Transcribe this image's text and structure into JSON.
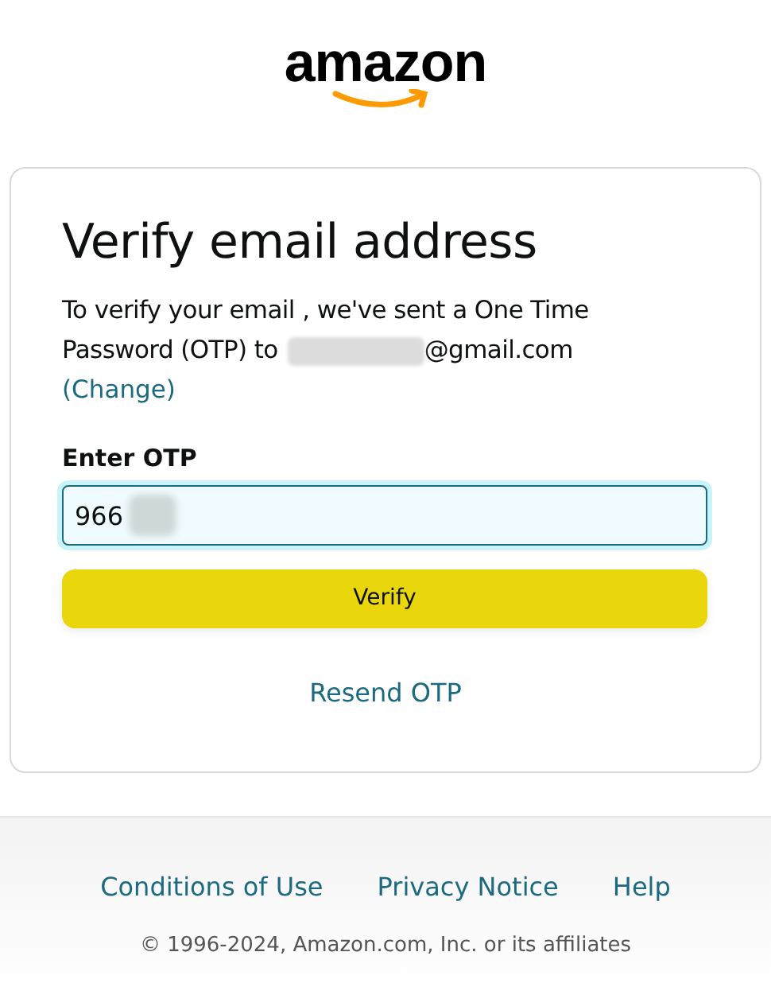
{
  "logo": {
    "text": "amazon"
  },
  "card": {
    "title": "Verify email address",
    "message_lines": [
      "To verify your email , we've sent a One Time",
      "Password (OTP) to"
    ],
    "email_domain": "@gmail.com",
    "change_link": "(Change)",
    "otp_label": "Enter OTP",
    "otp_value": "966",
    "verify_button": "Verify",
    "resend_link": "Resend OTP"
  },
  "footer": {
    "links": [
      "Conditions of Use",
      "Privacy Notice",
      "Help"
    ],
    "copyright": "© 1996-2024, Amazon.com, Inc. or its affiliates"
  }
}
